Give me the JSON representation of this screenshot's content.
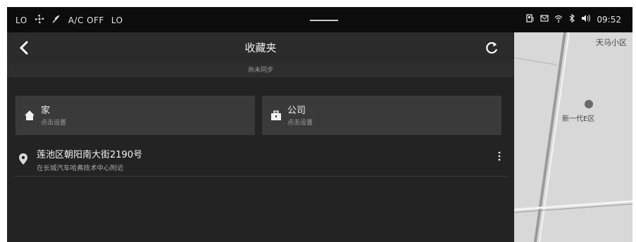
{
  "status": {
    "left_text": "LO",
    "ac_text": "A/C OFF",
    "lo_right": "LO",
    "time": "09:52"
  },
  "header": {
    "title": "收藏夹",
    "sync_note": "尚未同步"
  },
  "home": {
    "label": "家",
    "sub": "点击设置"
  },
  "company": {
    "label": "公司",
    "sub": "点击设置"
  },
  "favorites": [
    {
      "name": "莲池区朝阳南大街2190号",
      "detail": "在长城汽车哈弗技术中心附近"
    }
  ],
  "map": {
    "label_top_right": "天马小区",
    "label_poi": "新一代E区"
  },
  "colors": {
    "panel_bg": "#232323",
    "card_bg": "#3a3a3a",
    "map_bg": "#d8d8d8"
  }
}
